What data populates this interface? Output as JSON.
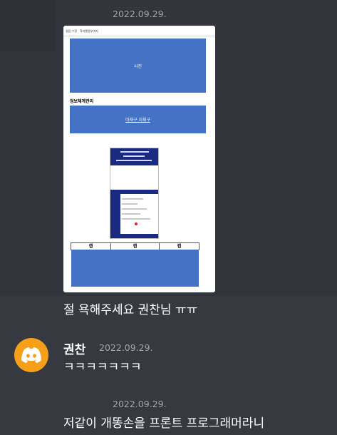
{
  "messages": [
    {
      "timestamp": "2022.09.29.",
      "attachment": {
        "tabs": [
          "걸음 수정",
          "학과행정부역지"
        ],
        "photo_label": "사진",
        "section_title": "정보체계관리",
        "link_text": "미래구 지휘구",
        "table_headers": [
          "캡",
          "캡",
          "캡"
        ]
      },
      "text": "절 욕해주세요 권찬님 ㅠㅠ"
    },
    {
      "author": "권찬",
      "timestamp": "2022.09.29.",
      "avatar_icon": "discord-logo-icon",
      "avatar_color": "#f6a01a",
      "text": "ㅋㅋㅋㅋㅋㅋㅋ"
    },
    {
      "timestamp": "2022.09.29.",
      "text": "저같이 개똥손을 프론트 프로그래머라니"
    }
  ],
  "colors": {
    "background": "#36393f",
    "hover_background": "#32353b",
    "timestamp": "#a3a6aa",
    "message_text": "#ffffff",
    "attachment_blue": "#4472c4"
  }
}
